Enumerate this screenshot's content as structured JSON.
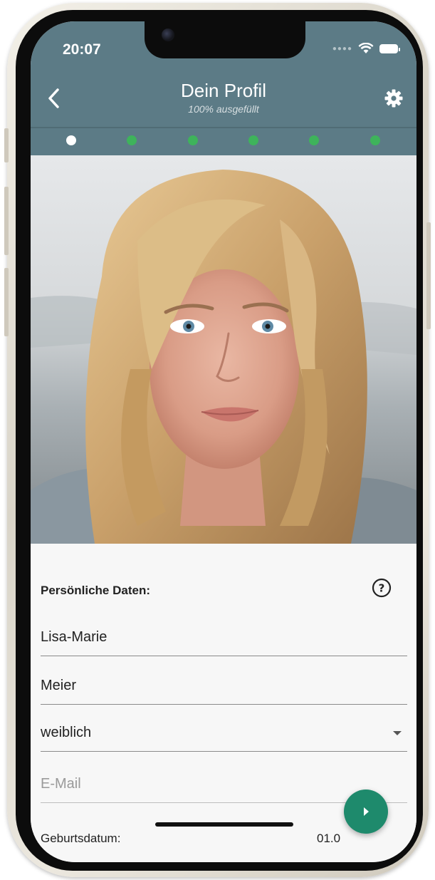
{
  "status_bar": {
    "time": "20:07"
  },
  "header": {
    "title": "Dein Profil",
    "subtitle": "100% ausgefüllt",
    "back_icon": "chevron-left-icon",
    "settings_icon": "gear-icon",
    "background_color": "#5c7b86"
  },
  "pager": {
    "total": 6,
    "active_index": 0,
    "active_color": "#ffffff",
    "inactive_color": "#3eb35b"
  },
  "form": {
    "section_title": "Persönliche Daten:",
    "help_icon": "help-circle-icon",
    "first_name": "Lisa-Marie",
    "last_name": "Meier",
    "gender": "weiblich",
    "email_placeholder": "E-Mail",
    "birthdate_label": "Geburtsdatum:",
    "birthdate_value": "01.0"
  },
  "fab": {
    "icon": "play-icon",
    "color": "#1e8a6c"
  }
}
